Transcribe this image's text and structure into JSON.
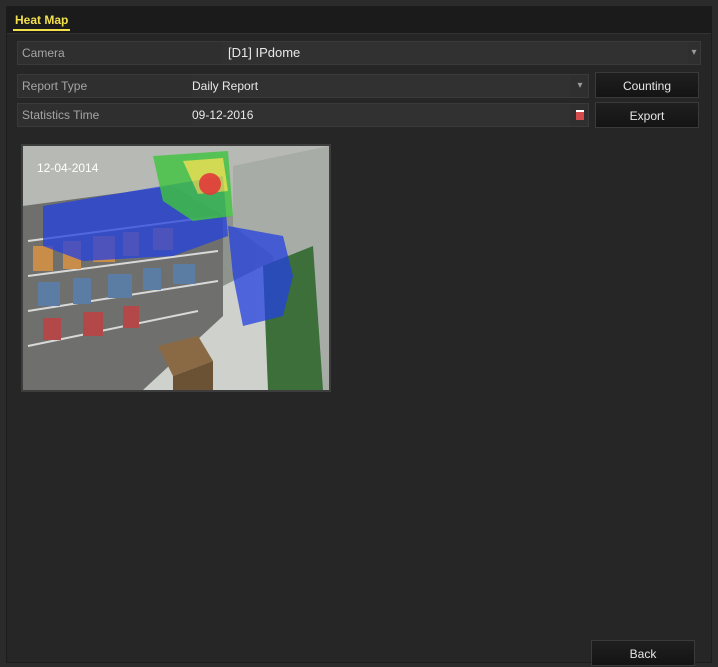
{
  "header": {
    "tab_label": "Heat Map"
  },
  "form": {
    "camera": {
      "label": "Camera",
      "value": "[D1] IPdome"
    },
    "report_type": {
      "label": "Report Type",
      "value": "Daily Report"
    },
    "statistics_time": {
      "label": "Statistics Time",
      "value": "09-12-2016"
    }
  },
  "buttons": {
    "counting": "Counting",
    "export": "Export",
    "back": "Back"
  },
  "preview": {
    "timestamp": "12-04-2014"
  },
  "icons": {
    "dropdown": "chevron-down-icon",
    "calendar": "calendar-icon"
  },
  "colors": {
    "accent": "#f2e04c",
    "background": "#262626"
  }
}
